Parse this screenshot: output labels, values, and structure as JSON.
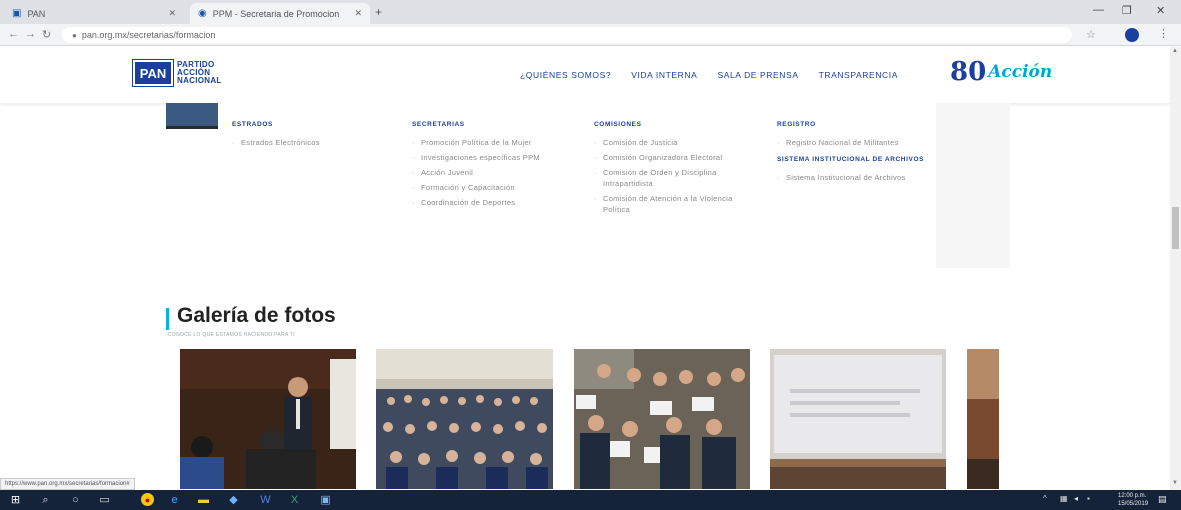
{
  "browser": {
    "tabs": [
      {
        "label": "PAN"
      },
      {
        "label": "PPM - Secretaria de Promocion"
      }
    ],
    "url": "pan.org.mx/secretarias/formacion"
  },
  "site": {
    "logo": {
      "mark": "PAN",
      "line1": "PARTIDO",
      "line2": "ACCIÓN",
      "line3": "NACIONAL"
    },
    "nav": [
      {
        "label": "¿QUIÉNES SOMOS?"
      },
      {
        "label": "VIDA INTERNA"
      },
      {
        "label": "SALA DE PRENSA"
      },
      {
        "label": "TRANSPARENCIA"
      }
    ],
    "badge": {
      "number": "80",
      "script": "Acción"
    }
  },
  "dropdown": {
    "estrados": {
      "heading": "ESTRADOS",
      "items": [
        "Estrados Electrónicos"
      ]
    },
    "secretarias": {
      "heading": "SECRETARIAS",
      "items": [
        "Promoción Política de la Mujer",
        "Investigaciones específicas PPM",
        "Acción Juvenil",
        "Formación y Capacitación",
        "Coordinación de Deportes"
      ]
    },
    "comisiones": {
      "heading": "COMISIONES",
      "items": [
        "Comisión de Justicia",
        "Comisión Organizadora Electoral",
        "Comisión de Orden y Disciplina Intrapartidista",
        "Comisión de Atención a la Violencia Política"
      ]
    },
    "registro": {
      "heading": "REGISTRO",
      "items": [
        "Registro Nacional de Militantes"
      ]
    },
    "archivos": {
      "heading": "SISTEMA INSTITUCIONAL DE ARCHIVOS",
      "items": [
        "Sistema Institucional de Archivos"
      ]
    }
  },
  "gallery": {
    "title": "Galería de fotos",
    "subtitle": "CONOCE LO QUE ESTAMOS HACIENDO PARA TI"
  },
  "status_url": "https://www.pan.org.mx/secretarias/formacion#",
  "taskbar": {
    "clock_time": "12:00 p.m.",
    "clock_date": "15/05/2019"
  },
  "colors": {
    "brand_blue": "#1a3f9e",
    "accent_cyan": "#00b5e2",
    "taskbar": "#15233a"
  }
}
